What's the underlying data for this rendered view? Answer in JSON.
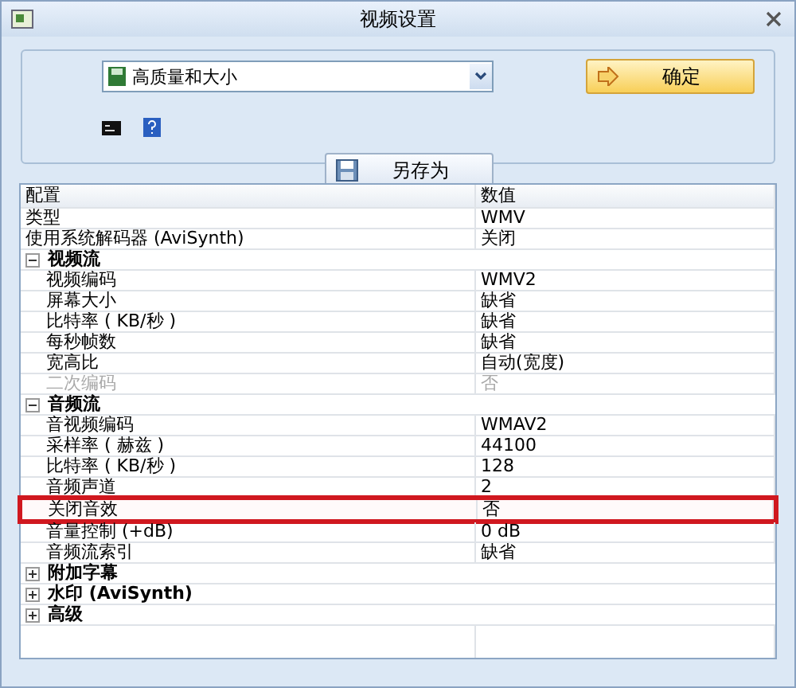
{
  "window": {
    "title": "视频设置"
  },
  "preset": {
    "value": "高质量和大小"
  },
  "buttons": {
    "ok": "确定",
    "save_as": "另存为"
  },
  "table": {
    "columns": [
      "配置",
      "数值"
    ],
    "rows": [
      {
        "kind": "row",
        "name": "类型",
        "value": "WMV",
        "disabled": false,
        "highlighted": false
      },
      {
        "kind": "row",
        "name": "使用系统解码器 (AviSynth)",
        "value": "关闭",
        "disabled": false,
        "highlighted": false
      },
      {
        "kind": "group",
        "name": "视频流",
        "expanded": true,
        "children": [
          {
            "kind": "row",
            "name": "视频编码",
            "value": "WMV2",
            "disabled": false,
            "highlighted": false
          },
          {
            "kind": "row",
            "name": "屏幕大小",
            "value": "缺省",
            "disabled": false,
            "highlighted": false
          },
          {
            "kind": "row",
            "name": "比特率 ( KB/秒 )",
            "value": "缺省",
            "disabled": false,
            "highlighted": false
          },
          {
            "kind": "row",
            "name": "每秒帧数",
            "value": "缺省",
            "disabled": false,
            "highlighted": false
          },
          {
            "kind": "row",
            "name": "宽高比",
            "value": "自动(宽度)",
            "disabled": false,
            "highlighted": false
          },
          {
            "kind": "row",
            "name": "二次编码",
            "value": "否",
            "disabled": true,
            "highlighted": false
          }
        ]
      },
      {
        "kind": "group",
        "name": "音频流",
        "expanded": true,
        "children": [
          {
            "kind": "row",
            "name": "音视频编码",
            "value": "WMAV2",
            "disabled": false,
            "highlighted": false
          },
          {
            "kind": "row",
            "name": "采样率 ( 赫兹 )",
            "value": "44100",
            "disabled": false,
            "highlighted": false
          },
          {
            "kind": "row",
            "name": "比特率 ( KB/秒 )",
            "value": "128",
            "disabled": false,
            "highlighted": false
          },
          {
            "kind": "row",
            "name": "音频声道",
            "value": "2",
            "disabled": false,
            "highlighted": false
          },
          {
            "kind": "row",
            "name": "关闭音效",
            "value": "否",
            "disabled": false,
            "highlighted": true
          },
          {
            "kind": "row",
            "name": "音量控制 (+dB)",
            "value": "0 dB",
            "disabled": false,
            "highlighted": false
          },
          {
            "kind": "row",
            "name": "音频流索引",
            "value": "缺省",
            "disabled": false,
            "highlighted": false
          }
        ]
      },
      {
        "kind": "group",
        "name": "附加字幕",
        "expanded": false,
        "children": []
      },
      {
        "kind": "group",
        "name": "水印 (AviSynth)",
        "expanded": false,
        "children": []
      },
      {
        "kind": "group",
        "name": "高级",
        "expanded": false,
        "children": []
      }
    ]
  }
}
